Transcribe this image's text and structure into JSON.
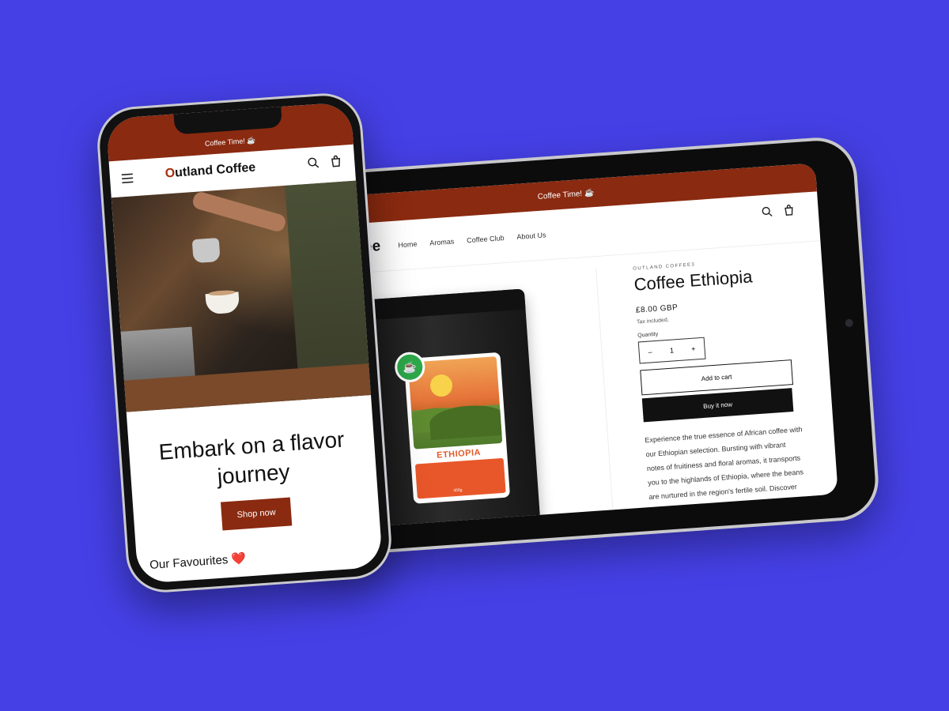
{
  "tablet": {
    "announcement": "Coffee Time! ☕",
    "logo": "Coffee",
    "nav": [
      "Home",
      "Aromas",
      "Coffee Club",
      "About Us"
    ],
    "vendor": "OUTLAND COFFEE3",
    "product_title": "Coffee Ethiopia",
    "price": "£8.00 GBP",
    "tax_note": "Tax included.",
    "quantity_label": "Quantity",
    "quantity_value": "1",
    "minus": "–",
    "plus": "+",
    "add_to_cart": "Add to cart",
    "buy_now": "Buy it now",
    "description": "Experience the true essence of African coffee with our Ethiopian selection. Bursting with vibrant notes of fruitiness and floral aromas, it transports you to the highlands of Ethiopia, where the beans are nurtured in the region's fertile soil. Discover the hidden gem that has captivated coffee connoisseurs",
    "bag_label": "ETHIOPIA",
    "bag_weight": "400g"
  },
  "phone": {
    "announcement": "Coffee Time! ☕",
    "logo_prefix": "O",
    "logo_rest": "utland Coffee",
    "hero_heading": "Embark on a flavor journey",
    "shop_button": "Shop now",
    "favourites": "Our Favourites ❤️"
  },
  "colors": {
    "background": "#4540e6",
    "brand": "#8a2a10"
  }
}
